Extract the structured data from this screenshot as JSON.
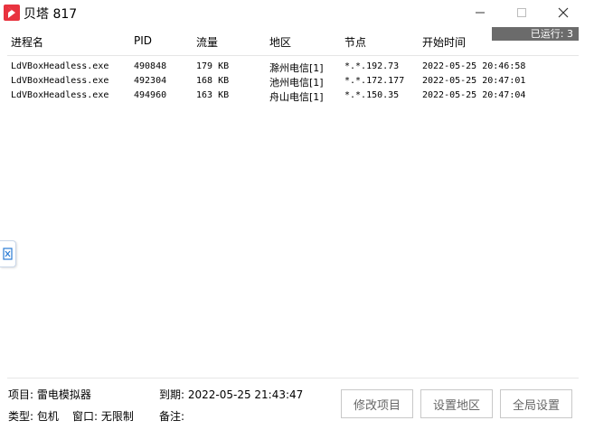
{
  "window": {
    "title": "贝塔 817",
    "running_label": "已运行: 3"
  },
  "table": {
    "columns": [
      "进程名",
      "PID",
      "流量",
      "地区",
      "节点",
      "开始时间"
    ],
    "rows": [
      {
        "name": "LdVBoxHeadless.exe",
        "pid": "490848",
        "traffic": "179 KB",
        "region": "滁州电信[1]",
        "node": "*.*.192.73",
        "start": "2022-05-25 20:46:58"
      },
      {
        "name": "LdVBoxHeadless.exe",
        "pid": "492304",
        "traffic": "168 KB",
        "region": "池州电信[1]",
        "node": "*.*.172.177",
        "start": "2022-05-25 20:47:01"
      },
      {
        "name": "LdVBoxHeadless.exe",
        "pid": "494960",
        "traffic": "163 KB",
        "region": "舟山电信[1]",
        "node": "*.*.150.35",
        "start": "2022-05-25 20:47:04"
      }
    ]
  },
  "footer": {
    "project": "项目: 雷电模拟器",
    "expire": "到期: 2022-05-25 21:43:47",
    "type": "类型: 包机",
    "window_mode": "窗口: 无限制",
    "note": "备注:"
  },
  "buttons": {
    "edit_project": "修改项目",
    "set_region": "设置地区",
    "global_settings": "全局设置"
  },
  "icons": {
    "app": "beta-app-icon",
    "minimize": "minimize-icon",
    "maximize": "maximize-icon",
    "close": "close-icon",
    "edge": "side-widget-icon"
  },
  "colors": {
    "app_icon": "#e8333f",
    "badge_bg": "#6b6b6b",
    "button_border": "#c8c8c8",
    "button_text": "#666666"
  }
}
